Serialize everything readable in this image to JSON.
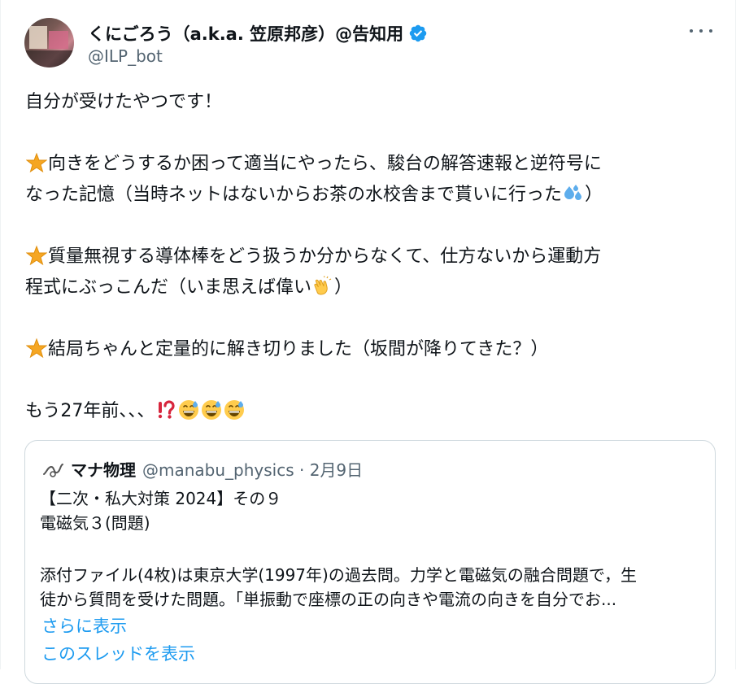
{
  "author": {
    "display_name": "くにごろう（a.k.a. 笠原邦彦）@告知用",
    "handle": "@ILP_bot",
    "verified": true,
    "verified_icon": "verified-badge-icon",
    "avatar_icon": "profile-avatar"
  },
  "menu": {
    "icon": "more-options-icon"
  },
  "tweet": {
    "line1": "自分が受けたやつです！",
    "bullet1_line1": "向きをどうするか困って適当にやったら、駿台の解答速報と逆符号に",
    "bullet1_line2": "なった記憶（当時ネットはないからお茶の水校舎まで貰いに行った",
    "bullet1_line2_end": "）",
    "bullet2_line1": "質量無視する導体棒をどう扱うか分からなくて、仕方ないから運動方",
    "bullet2_line2": "程式にぶっこんだ（いま思えば偉い",
    "bullet2_line2_end": "）",
    "bullet3": "結局ちゃんと定量的に解き切りました（坂間が降りてきた？）",
    "last_line": "もう27年前、、、",
    "emoji_icons": [
      "star-emoji",
      "sweat-droplets-emoji",
      "clapping-hands-emoji",
      "exclamation-question-emoji",
      "grinning-sweat-emoji"
    ]
  },
  "quoted": {
    "name": "マナ物理",
    "handle_date": "@manabu_physics · 2月9日",
    "line1": "【二次・私大対策 2024】その９",
    "line2": "電磁気３(問題)",
    "para1": "添付ファイル(4枚)は東京大学(1997年)の過去問。力学と電磁気の融合問題で，生",
    "para2": "徒から質問を受けた問題。「単振動で座標の正の向きや電流の向きを自分でお...",
    "show_more": "さらに表示",
    "show_thread": "このスレッドを表示"
  },
  "colors": {
    "accent": "#1d9bf0",
    "text": "#0f1419",
    "muted": "#536471",
    "border": "#cfd9de"
  }
}
